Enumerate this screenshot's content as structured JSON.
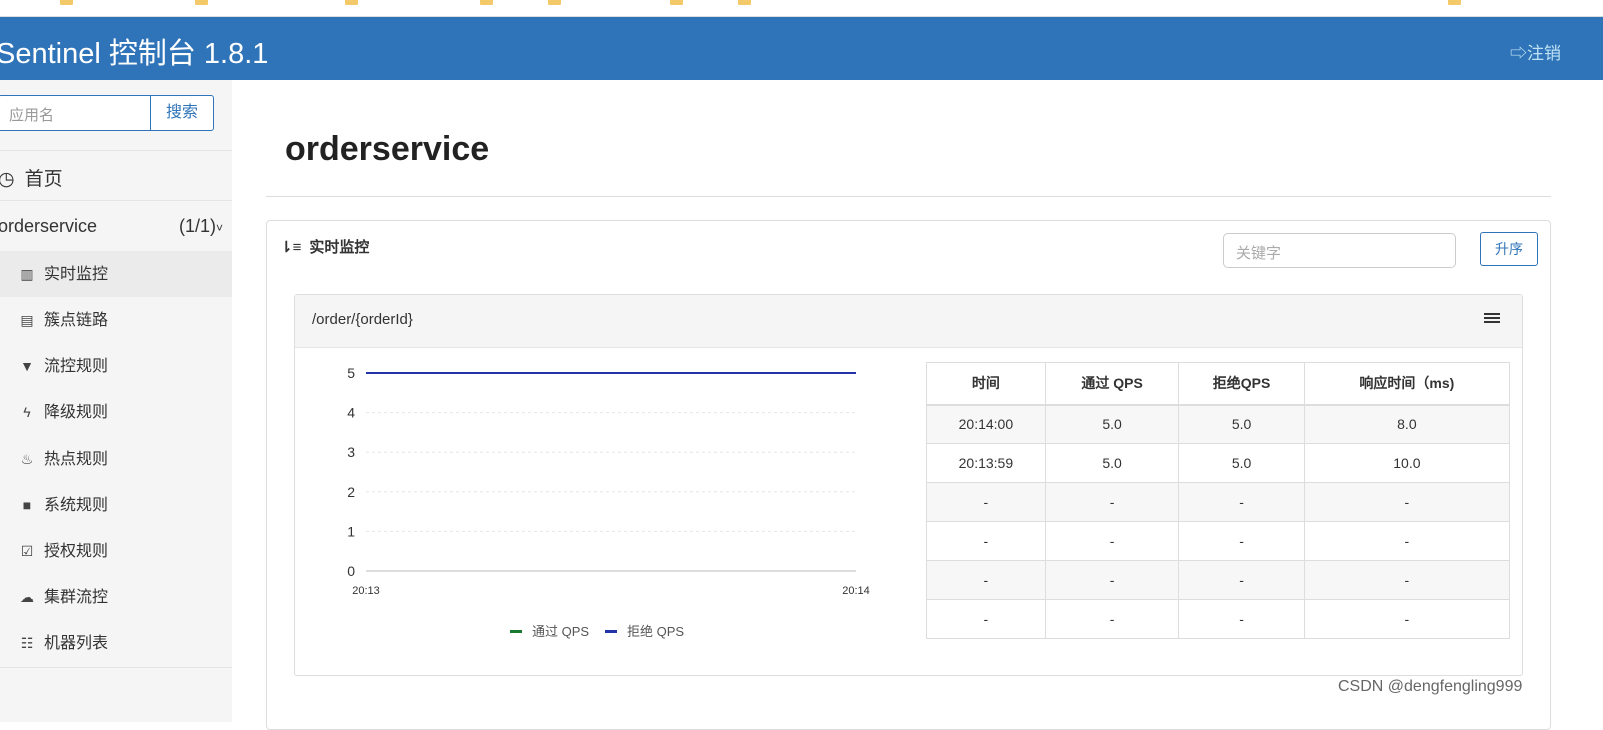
{
  "header": {
    "brand": "Sentinel 控制台 1.8.1",
    "logout": "注销"
  },
  "sidebar": {
    "search_placeholder": "应用名",
    "search_button": "搜索",
    "home": "首页",
    "app": {
      "name": "orderservice",
      "count": "(1/1)"
    },
    "items": [
      {
        "label": "实时监控",
        "icon": "bar-chart-icon"
      },
      {
        "label": "簇点链路",
        "icon": "list-icon"
      },
      {
        "label": "流控规则",
        "icon": "filter-icon"
      },
      {
        "label": "降级规则",
        "icon": "flash-icon"
      },
      {
        "label": "热点规则",
        "icon": "fire-icon"
      },
      {
        "label": "系统规则",
        "icon": "lock-icon"
      },
      {
        "label": "授权规则",
        "icon": "check-icon"
      },
      {
        "label": "集群流控",
        "icon": "cloud-icon"
      },
      {
        "label": "机器列表",
        "icon": "th-list-icon"
      }
    ]
  },
  "main": {
    "title": "orderservice",
    "section_title": "实时监控",
    "keyword_placeholder": "关键字",
    "sort_button": "升序",
    "resource": "/order/{orderId}",
    "table": {
      "headers": [
        "时间",
        "通过 QPS",
        "拒绝QPS",
        "响应时间（ms)"
      ],
      "rows": [
        [
          "20:14:00",
          "5.0",
          "5.0",
          "8.0"
        ],
        [
          "20:13:59",
          "5.0",
          "5.0",
          "10.0"
        ],
        [
          "-",
          "-",
          "-",
          "-"
        ],
        [
          "-",
          "-",
          "-",
          "-"
        ],
        [
          "-",
          "-",
          "-",
          "-"
        ],
        [
          "-",
          "-",
          "-",
          "-"
        ]
      ]
    }
  },
  "chart_data": {
    "type": "line",
    "x": [
      "20:13",
      "20:14"
    ],
    "yticks": [
      "0",
      "1",
      "2",
      "3",
      "4",
      "5"
    ],
    "ylim": [
      0,
      5
    ],
    "series": [
      {
        "name": "通过 QPS",
        "color": "#1a7a2e",
        "values": [
          5,
          5
        ]
      },
      {
        "name": "拒绝 QPS",
        "color": "#2233aa",
        "values": [
          5,
          5
        ]
      }
    ],
    "legend": "bottom"
  },
  "watermark": "CSDN @dengfengling999"
}
